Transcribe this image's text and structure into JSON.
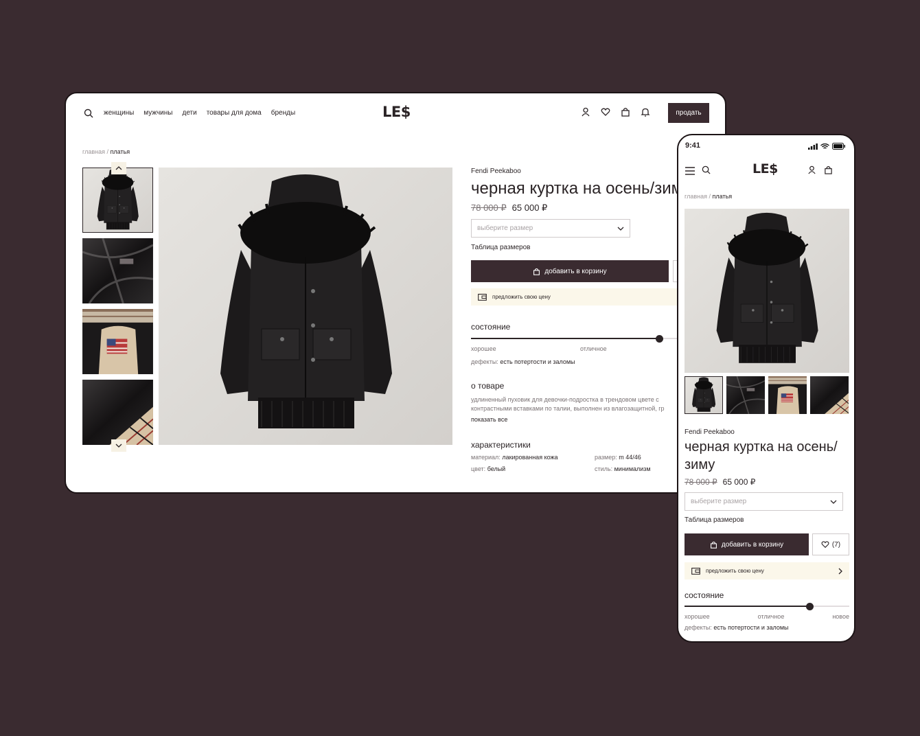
{
  "desktop": {
    "nav": {
      "links": [
        "женщины",
        "мужчины",
        "дети",
        "товары для дома",
        "бренды"
      ],
      "logo": "LE$",
      "sell_label": "продать"
    },
    "breadcrumb": {
      "home": "главная",
      "sep": "/",
      "current": "платья"
    },
    "product": {
      "brand": "Fendi Peekaboo",
      "title": "черная куртка на осень/зиму",
      "old_price": "78 000 ₽",
      "price": "65 000 ₽",
      "size_placeholder": "выберите размер",
      "size_table": "Таблица размеров",
      "add_to_cart": "добавить в корзину",
      "offer_price": "предложить свою цену",
      "condition": {
        "heading": "состояние",
        "labels": [
          "хорошее",
          "отличное"
        ],
        "level": 0.72,
        "defects_label": "дефекты:",
        "defects_value": "есть потертости и заломы"
      },
      "about": {
        "heading": "о товаре",
        "text_1": "удлиненный пуховик для девочки-подростка в трендовом цвете с",
        "text_2": "контрастными вставками по талии, выполнен из влагозащитной, гр",
        "show_all": "показать все"
      },
      "specs": {
        "heading": "характеристики",
        "material_label": "материал:",
        "material_value": "лакированная кожа",
        "size_label": "размер:",
        "size_value": "m 44/46",
        "color_label": "цвет:",
        "color_value": "белый",
        "style_label": "стиль:",
        "style_value": "минимализм"
      }
    }
  },
  "phone": {
    "time": "9:41",
    "logo": "LE$",
    "breadcrumb": {
      "home": "главная",
      "sep": "/",
      "current": "платья"
    },
    "product": {
      "brand": "Fendi Peekaboo",
      "title_line1": "черная куртка на осень/",
      "title_line2": "зиму",
      "old_price": "78 000 ₽",
      "price": "65 000 ₽",
      "size_placeholder": "выберите размер",
      "size_table": "Таблица размеров",
      "add_to_cart": "добавить в корзину",
      "fav_count": "(7)",
      "offer_price": "предложить свою цену",
      "condition": {
        "heading": "состояние",
        "labels": [
          "хорошее",
          "отличное",
          "новое"
        ],
        "level": 0.76,
        "defects_label": "дефекты:",
        "defects_value": "есть потертости и заломы"
      }
    }
  },
  "colors": {
    "accent": "#3a2b30",
    "background": "#3a2b30",
    "offer_bg": "#fbf7ea"
  }
}
